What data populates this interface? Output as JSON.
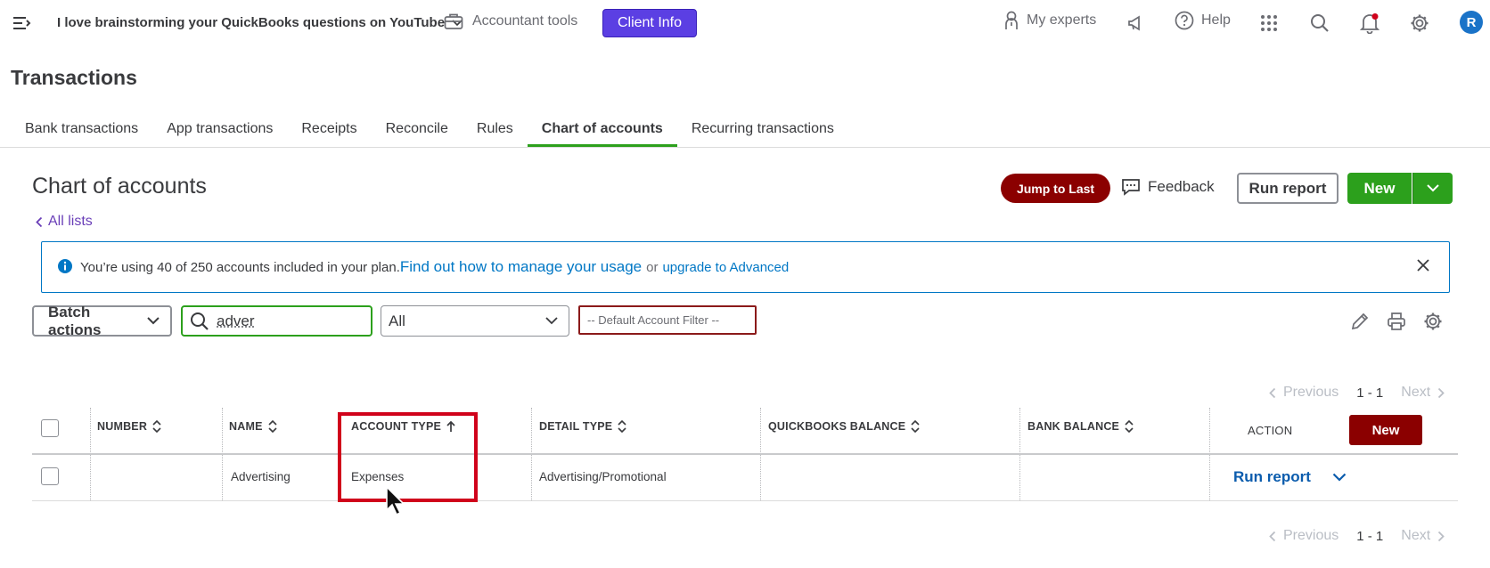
{
  "topbar": {
    "company_name": "I love brainstorming your QuickBooks questions on YouTube",
    "accountant_tools": "Accountant tools",
    "client_info": "Client Info",
    "my_experts": "My experts",
    "help": "Help",
    "avatar_letter": "R"
  },
  "page": {
    "title": "Transactions"
  },
  "tabs": [
    {
      "label": "Bank transactions"
    },
    {
      "label": "App transactions"
    },
    {
      "label": "Receipts"
    },
    {
      "label": "Reconcile"
    },
    {
      "label": "Rules"
    },
    {
      "label": "Chart of accounts",
      "active": true
    },
    {
      "label": "Recurring transactions"
    }
  ],
  "section": {
    "title": "Chart of accounts",
    "back_link": "All lists",
    "jump_to_last": "Jump to Last",
    "feedback": "Feedback",
    "run_report": "Run report",
    "new": "New"
  },
  "banner": {
    "text": "You’re using 40 of 250 accounts included in your plan.",
    "link_manage": "Find out how to manage your usage",
    "or": "or",
    "link_upgrade": "upgrade to Advanced"
  },
  "filters": {
    "batch_actions": "Batch actions",
    "search_value": "adver",
    "type_select": "All",
    "default_filter": "-- Default Account Filter --"
  },
  "pager": {
    "previous": "Previous",
    "range": "1 - 1",
    "next": "Next"
  },
  "table": {
    "headers": {
      "number": "NUMBER",
      "name": "NAME",
      "account_type": "ACCOUNT TYPE",
      "detail_type": "DETAIL TYPE",
      "qb_balance": "QUICKBOOKS BALANCE",
      "bank_balance": "BANK BALANCE",
      "action": "ACTION",
      "new": "New"
    },
    "rows": [
      {
        "number": "",
        "name": "Advertising",
        "account_type": "Expenses",
        "detail_type": "Advertising/Promotional",
        "qb_balance": "",
        "bank_balance": "",
        "action": "Run report"
      }
    ]
  },
  "colors": {
    "brand_green": "#2ca01c",
    "client_info_purple": "#5b3fe3",
    "dark_red": "#8b0000",
    "link_blue": "#0077c5",
    "highlight_red": "#d0021b"
  }
}
